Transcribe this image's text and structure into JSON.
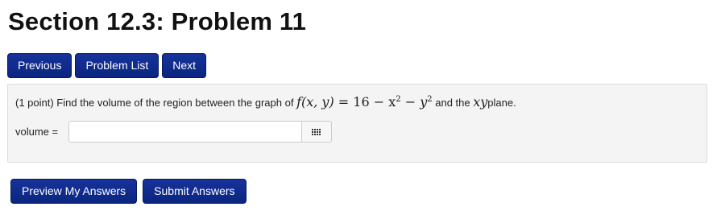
{
  "page": {
    "title": "Section 12.3: Problem 11"
  },
  "nav": {
    "previous_label": "Previous",
    "problem_list_label": "Problem List",
    "next_label": "Next"
  },
  "problem": {
    "text_before": "(1 point) Find the volume of the region between the graph of ",
    "math_f": "f",
    "math_args": "(x, y)",
    "math_eq": " = 16 − x",
    "math_exp1": "2",
    "math_minus_y": " − y",
    "math_exp2": "2",
    "text_middle": " and the ",
    "math_xy": "xy",
    "text_after": "plane."
  },
  "answer": {
    "label": "volume =",
    "value": "",
    "keypad_icon": "grid-keypad-icon"
  },
  "actions": {
    "preview_label": "Preview My Answers",
    "submit_label": "Submit Answers"
  },
  "colors": {
    "button_bg": "#0a2680",
    "box_bg": "#f4f4f4"
  }
}
